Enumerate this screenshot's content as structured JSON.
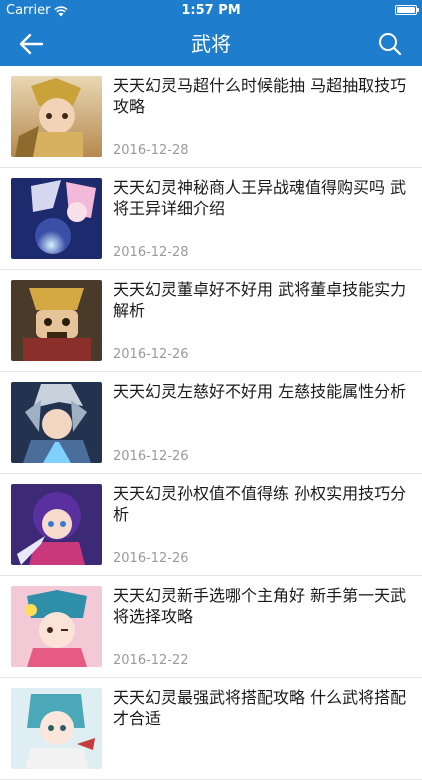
{
  "status_bar": {
    "carrier": "Carrier",
    "time": "1:57 PM",
    "battery_level": 1.0
  },
  "nav": {
    "title": "武将",
    "back_icon": "arrow-left-icon",
    "search_icon": "search-icon"
  },
  "colors": {
    "header": "#1e7ecd",
    "title_text": "#1a1a1a",
    "date_text": "#9a9a9a"
  },
  "articles": [
    {
      "title": "天天幻灵马超什么时候能抽 马超抽取技巧攻略",
      "date": "2016-12-28"
    },
    {
      "title": "天天幻灵神秘商人王异战魂值得购买吗 武将王异详细介绍",
      "date": "2016-12-28"
    },
    {
      "title": "天天幻灵董卓好不好用 武将董卓技能实力解析",
      "date": "2016-12-26"
    },
    {
      "title": "天天幻灵左慈好不好用 左慈技能属性分析",
      "date": "2016-12-26"
    },
    {
      "title": "天天幻灵孙权值不值得练 孙权实用技巧分析",
      "date": "2016-12-26"
    },
    {
      "title": "天天幻灵新手选哪个主角好 新手第一天武将选择攻略",
      "date": "2016-12-22"
    },
    {
      "title": "天天幻灵最强武将搭配攻略 什么武将搭配才合适",
      "date": ""
    }
  ]
}
